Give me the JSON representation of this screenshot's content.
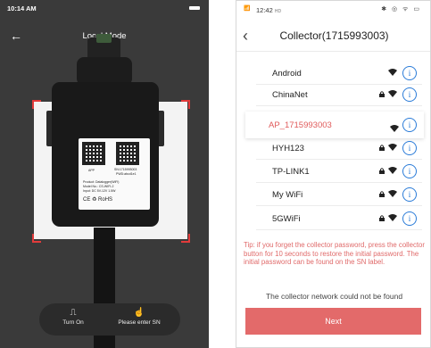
{
  "left_screen": {
    "status_time": "10:14 AM",
    "title": "Local Mode",
    "back_icon": "arrow-left-icon",
    "label": {
      "app_text": "APP",
      "sn_text": "SN:1715993003",
      "pwd_text": "PWD:abcd1e1",
      "product_line": "Product:      Datalogger(WiFi)",
      "model_line": "Model No.:         CS-WIFI-2",
      "input_line": "Input:           DC 5V-12V 1.5W",
      "marks": "CE  ♻  RoHS"
    },
    "actions": [
      {
        "label": "Turn On",
        "icon": "flashlight-icon"
      },
      {
        "label": "Please enter SN",
        "icon": "hand-pointer-icon"
      }
    ]
  },
  "right_screen": {
    "status_time": "12:42",
    "status_small": "HD",
    "status_icons": "✱ ◎ ᯤ ▭",
    "title": "Collector(1715993003)",
    "wifi_list": [
      {
        "name": "Android",
        "locked": false
      },
      {
        "name": "ChinaNet",
        "locked": true
      },
      {
        "name": "HYH123",
        "locked": true
      },
      {
        "name": "TP-LINK1",
        "locked": true
      },
      {
        "name": "My WiFi",
        "locked": true
      },
      {
        "name": "5GWiFi",
        "locked": true
      }
    ],
    "selected_network": "AP_1715993003",
    "tip": "Tip: if you forget the collector password, press the collector button for 10 seconds to restore the initial password. The initial password can be found on the SN label.",
    "not_found": "The collector network could not be found",
    "next_label": "Next",
    "accent_color": "#e36a6a",
    "info_color": "#2a7bd8"
  }
}
